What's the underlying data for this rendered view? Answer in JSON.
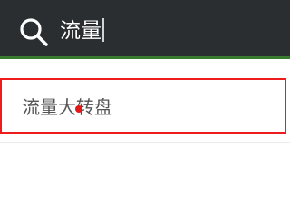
{
  "search": {
    "query": "流量",
    "icon": "search-icon"
  },
  "suggestions": [
    {
      "label": "流量大转盘"
    }
  ],
  "colors": {
    "bar_background": "#2b2e31",
    "underline": "#3a7a2e",
    "highlight_border": "#ee1c1c",
    "marker": "#e31818"
  }
}
